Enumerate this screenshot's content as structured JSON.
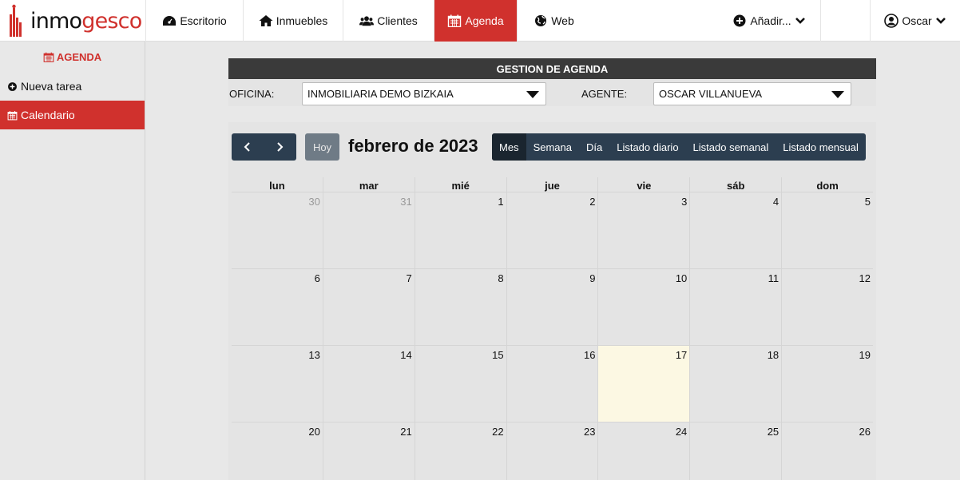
{
  "brand": {
    "part1": "inmo",
    "part2": "gesco",
    "accent": "#d0312d"
  },
  "nav": [
    {
      "icon": "dashboard-icon",
      "label": "Escritorio"
    },
    {
      "icon": "home-icon",
      "label": "Inmuebles"
    },
    {
      "icon": "users-icon",
      "label": "Clientes"
    },
    {
      "icon": "calendar-icon",
      "label": "Agenda",
      "active": true
    },
    {
      "icon": "globe-icon",
      "label": "Web"
    }
  ],
  "add_menu": {
    "icon": "plus-circle-icon",
    "label": "Añadir..."
  },
  "user_menu": {
    "icon": "user-circle-icon",
    "label": "Oscar"
  },
  "sidebar": {
    "title": "AGENDA",
    "items": [
      {
        "icon": "plus-circle-icon",
        "label": "Nueva tarea"
      },
      {
        "icon": "calendar-icon",
        "label": "Calendario",
        "active": true
      }
    ]
  },
  "agenda": {
    "header": "GESTION DE AGENDA",
    "office_label": "OFICINA:",
    "office_value": "INMOBILIARIA DEMO BIZKAIA",
    "agent_label": "AGENTE:",
    "agent_value": "OSCAR VILLANUEVA"
  },
  "calendar": {
    "prev_icon": "chevron-left-icon",
    "next_icon": "chevron-right-icon",
    "today_label": "Hoy",
    "title": "febrero de 2023",
    "views": [
      "Mes",
      "Semana",
      "Día",
      "Listado diario",
      "Listado semanal",
      "Listado mensual"
    ],
    "active_view": "Mes",
    "weekdays": [
      "lun",
      "mar",
      "mié",
      "jue",
      "vie",
      "sáb",
      "dom"
    ],
    "weeks": [
      [
        "30",
        "31",
        "1",
        "2",
        "3",
        "4",
        "5"
      ],
      [
        "6",
        "7",
        "8",
        "9",
        "10",
        "11",
        "12"
      ],
      [
        "13",
        "14",
        "15",
        "16",
        "17",
        "18",
        "19"
      ],
      [
        "20",
        "21",
        "22",
        "23",
        "24",
        "25",
        "26"
      ]
    ],
    "other_month_days": [
      "30",
      "31"
    ],
    "today": "17",
    "colors": {
      "toolbar": "#2c3e50",
      "active_view": "#1a252f",
      "today_bg": "#fcf8e3"
    }
  }
}
